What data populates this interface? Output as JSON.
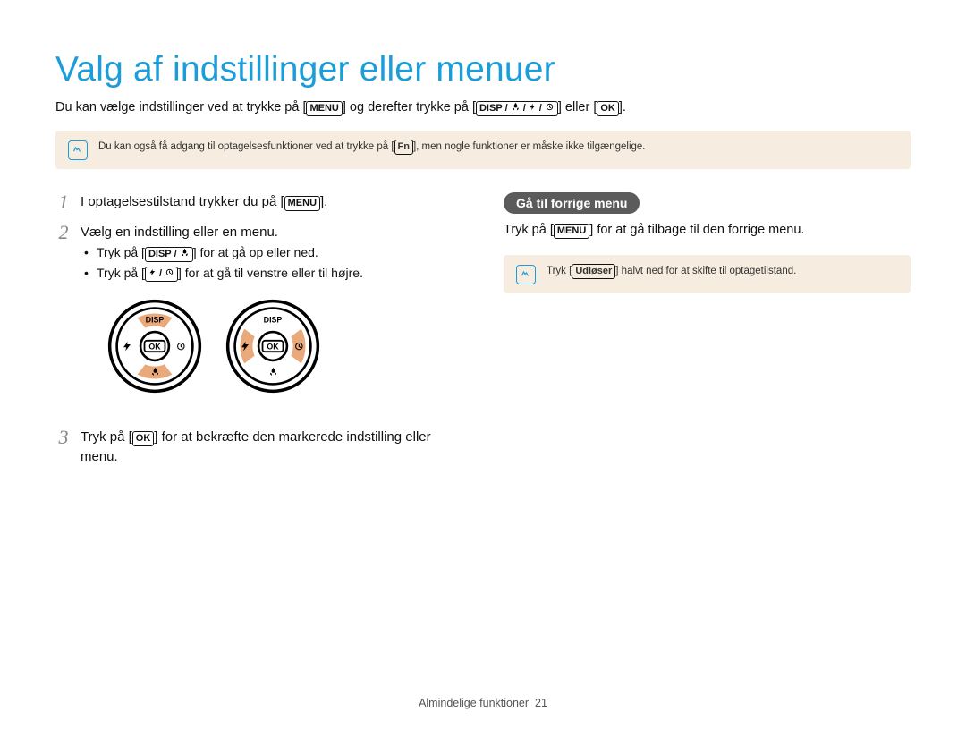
{
  "page": {
    "title": "Valg af indstillinger eller menuer",
    "intro_a": "Du kan vælge indstillinger ved at trykke på [",
    "intro_b": "] og derefter trykke på [",
    "intro_c": "] eller [",
    "intro_d": "].",
    "footer_label": "Almindelige funktioner",
    "footer_page": "21"
  },
  "keys": {
    "menu": "MENU",
    "disp": "DISP",
    "ok": "OK",
    "fn": "Fn",
    "shutter": "Udløser"
  },
  "note1": {
    "text_a": "Du kan også få adgang til optagelsesfunktioner ved at trykke på [",
    "text_b": "], men nogle funktioner er måske ikke tilgængelige."
  },
  "steps": {
    "s1": {
      "num": "1",
      "text_a": "I optagelsestilstand trykker du på [",
      "text_b": "]."
    },
    "s2": {
      "num": "2",
      "text": "Vælg en indstilling eller en menu.",
      "bullet1_a": "Tryk på [",
      "bullet1_b": "] for at gå op eller ned.",
      "bullet2_a": "Tryk på [",
      "bullet2_b": "] for at gå til venstre eller til højre."
    },
    "s3": {
      "num": "3",
      "text_a": "Tryk på [",
      "text_b": "] for at bekræfte den markerede indstilling eller menu."
    }
  },
  "right": {
    "pill": "Gå til forrige menu",
    "para_a": "Tryk på [",
    "para_b": "] for at gå tilbage til den forrige menu.",
    "note_a": "Tryk [",
    "note_b": "] halvt ned for at skifte til optagetilstand."
  },
  "dial": {
    "disp": "DISP",
    "ok": "OK"
  }
}
